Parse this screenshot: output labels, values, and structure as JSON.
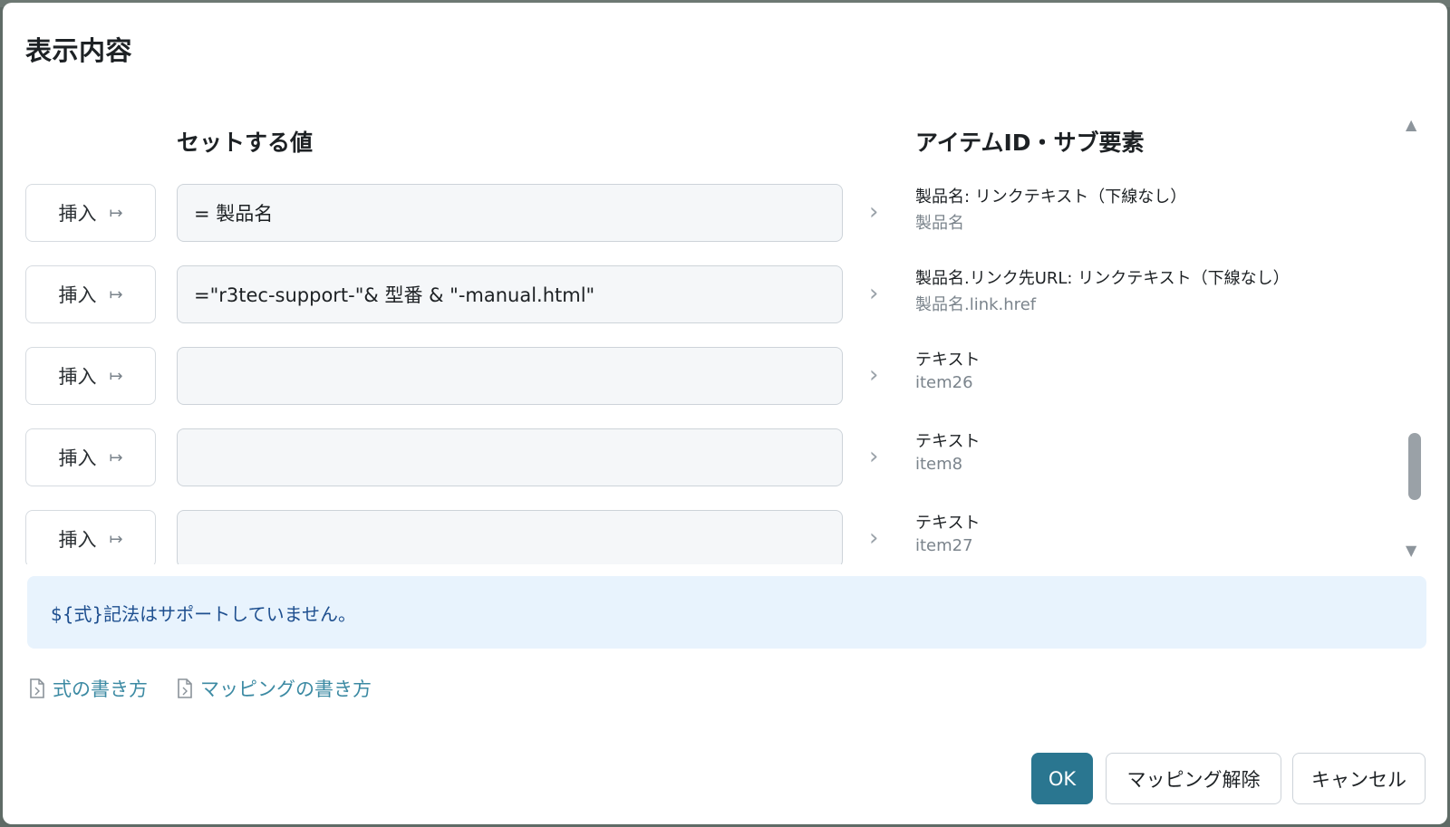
{
  "dialog": {
    "title": "表示内容",
    "column_value": "セットする値",
    "column_item": "アイテムID・サブ要素"
  },
  "rows": [
    {
      "insert_label": "挿入",
      "value": "= 製品名",
      "item_name": "製品名: リンクテキスト（下線なし）",
      "item_id": "製品名"
    },
    {
      "insert_label": "挿入",
      "value": "=\"r3tec-support-\"& 型番 & \"-manual.html\"",
      "item_name": "製品名.リンク先URL: リンクテキスト（下線なし）",
      "item_id": "製品名.link.href"
    },
    {
      "insert_label": "挿入",
      "value": "",
      "item_name": "テキスト",
      "item_id": "item26"
    },
    {
      "insert_label": "挿入",
      "value": "",
      "item_name": "テキスト",
      "item_id": "item8"
    },
    {
      "insert_label": "挿入",
      "value": "",
      "item_name": "テキスト",
      "item_id": "item27"
    }
  ],
  "notice": "${式}記法はサポートしていません。",
  "help_links": {
    "formula": "式の書き方",
    "mapping": "マッピングの書き方"
  },
  "buttons": {
    "ok": "OK",
    "unmap": "マッピング解除",
    "cancel": "キャンセル"
  },
  "icons": {
    "insert": "insert-arrow-icon",
    "row_arrow": "chevron-right-icon",
    "doc": "document-icon",
    "scroll_up": "scroll-up-icon",
    "scroll_down": "scroll-down-icon"
  },
  "colors": {
    "primary": "#2a7690",
    "link": "#3c8aa3",
    "notice_bg": "#e8f3fd",
    "notice_text": "#1e4f8f"
  }
}
